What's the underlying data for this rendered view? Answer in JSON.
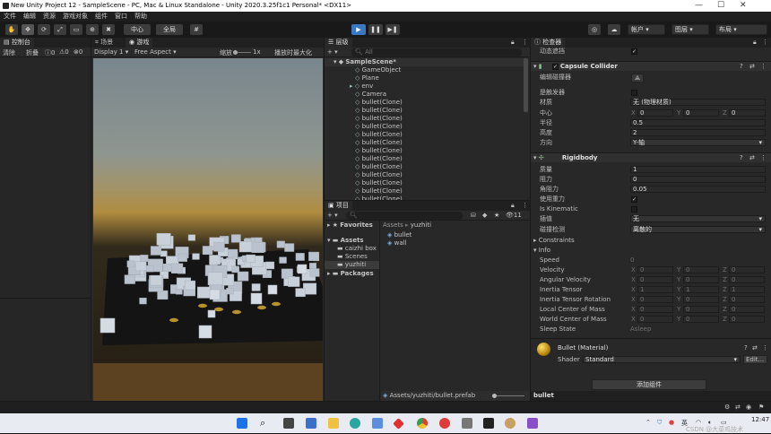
{
  "window": {
    "title": "New Unity Project 12 - SampleScene - PC, Mac & Linux Standalone - Unity 2020.3.25f1c1 Personal* <DX11>"
  },
  "menu": [
    "文件",
    "编辑",
    "资源",
    "游戏对象",
    "组件",
    "窗口",
    "帮助"
  ],
  "toolbar": {
    "pivot": "中心",
    "global": "全局",
    "account": "帐户",
    "layers": "图层",
    "layout": "布局"
  },
  "console_tab": {
    "label": "控制台",
    "clear": "清除",
    "collapse": "折叠",
    "count_log": "0",
    "count_warn": "0",
    "count_err": "0"
  },
  "scene_tabs": {
    "scene": "场景",
    "game": "游戏",
    "display": "Display 1",
    "aspect": "Free Aspect",
    "scale_label": "缩放",
    "scale_value": "1x",
    "maximize": "播放时最大化"
  },
  "hierarchy": {
    "tab": "层级",
    "search": "All",
    "scene": "SampleScene*",
    "items": [
      "GameObject",
      "Plane",
      "env",
      "Camera",
      "bullet(Clone)",
      "bullet(Clone)",
      "bullet(Clone)",
      "bullet(Clone)",
      "bullet(Clone)",
      "bullet(Clone)",
      "bullet(Clone)",
      "bullet(Clone)",
      "bullet(Clone)",
      "bullet(Clone)",
      "bullet(Clone)",
      "bullet(Clone)",
      "bullet(Clone)"
    ]
  },
  "project": {
    "tab": "项目",
    "count": "11",
    "tree": {
      "favorites": "Favorites",
      "assets": "Assets",
      "children": [
        "caizhi box",
        "Scenes",
        "yuzhiti"
      ],
      "packages": "Packages"
    },
    "breadcrumb": [
      "Assets",
      "yuzhiti"
    ],
    "files": [
      "bullet",
      "wall"
    ],
    "footer_path": "Assets/yuzhiti/bullet.prefab"
  },
  "inspector": {
    "tab": "检查器",
    "dynamic_occluder": "动态遮挡",
    "capsule": {
      "title": "Capsule Collider",
      "edit_label": "编辑碰撞器",
      "is_trigger": "是触发器",
      "material_label": "材质",
      "material_value": "无 (物理材质)",
      "center_label": "中心",
      "center": {
        "x": "0",
        "y": "0",
        "z": "0"
      },
      "radius_label": "半径",
      "radius": "0.5",
      "height_label": "高度",
      "height": "2",
      "direction_label": "方向",
      "direction": "Y-轴"
    },
    "rigidbody": {
      "title": "Rigidbody",
      "mass_label": "质量",
      "mass": "1",
      "drag_label": "阻力",
      "drag": "0",
      "angular_drag_label": "角阻力",
      "angular_drag": "0.05",
      "use_gravity_label": "使用重力",
      "kinematic_label": "Is Kinematic",
      "interpolate_label": "插值",
      "interpolate": "无",
      "collision_label": "碰撞检测",
      "collision": "离散的",
      "constraints": "Constraints",
      "info": "Info",
      "info_rows": [
        {
          "label": "Speed",
          "single": "0"
        },
        {
          "label": "Velocity",
          "x": "0",
          "y": "0",
          "z": "0"
        },
        {
          "label": "Angular Velocity",
          "x": "0",
          "y": "0",
          "z": "0"
        },
        {
          "label": "Inertia Tensor",
          "x": "1",
          "y": "1",
          "z": "1"
        },
        {
          "label": "Inertia Tensor Rotation",
          "x": "0",
          "y": "0",
          "z": "0"
        },
        {
          "label": "Local Center of Mass",
          "x": "0",
          "y": "0",
          "z": "0"
        },
        {
          "label": "World Center of Mass",
          "x": "0",
          "y": "0",
          "z": "0"
        },
        {
          "label": "Sleep State",
          "single": "Asleep"
        }
      ]
    },
    "material": {
      "title": "Bullet (Material)",
      "shader_label": "Shader",
      "shader": "Standard",
      "edit": "Edit..."
    },
    "add_component": "添加组件",
    "footer": "bullet"
  },
  "taskbar": {
    "time": "12:47",
    "watermark": "CSDN @大菜鸡技术"
  },
  "colors": {
    "accent": "#3a78c4",
    "panel": "#282828",
    "taskbar": "#e8ecf2"
  }
}
